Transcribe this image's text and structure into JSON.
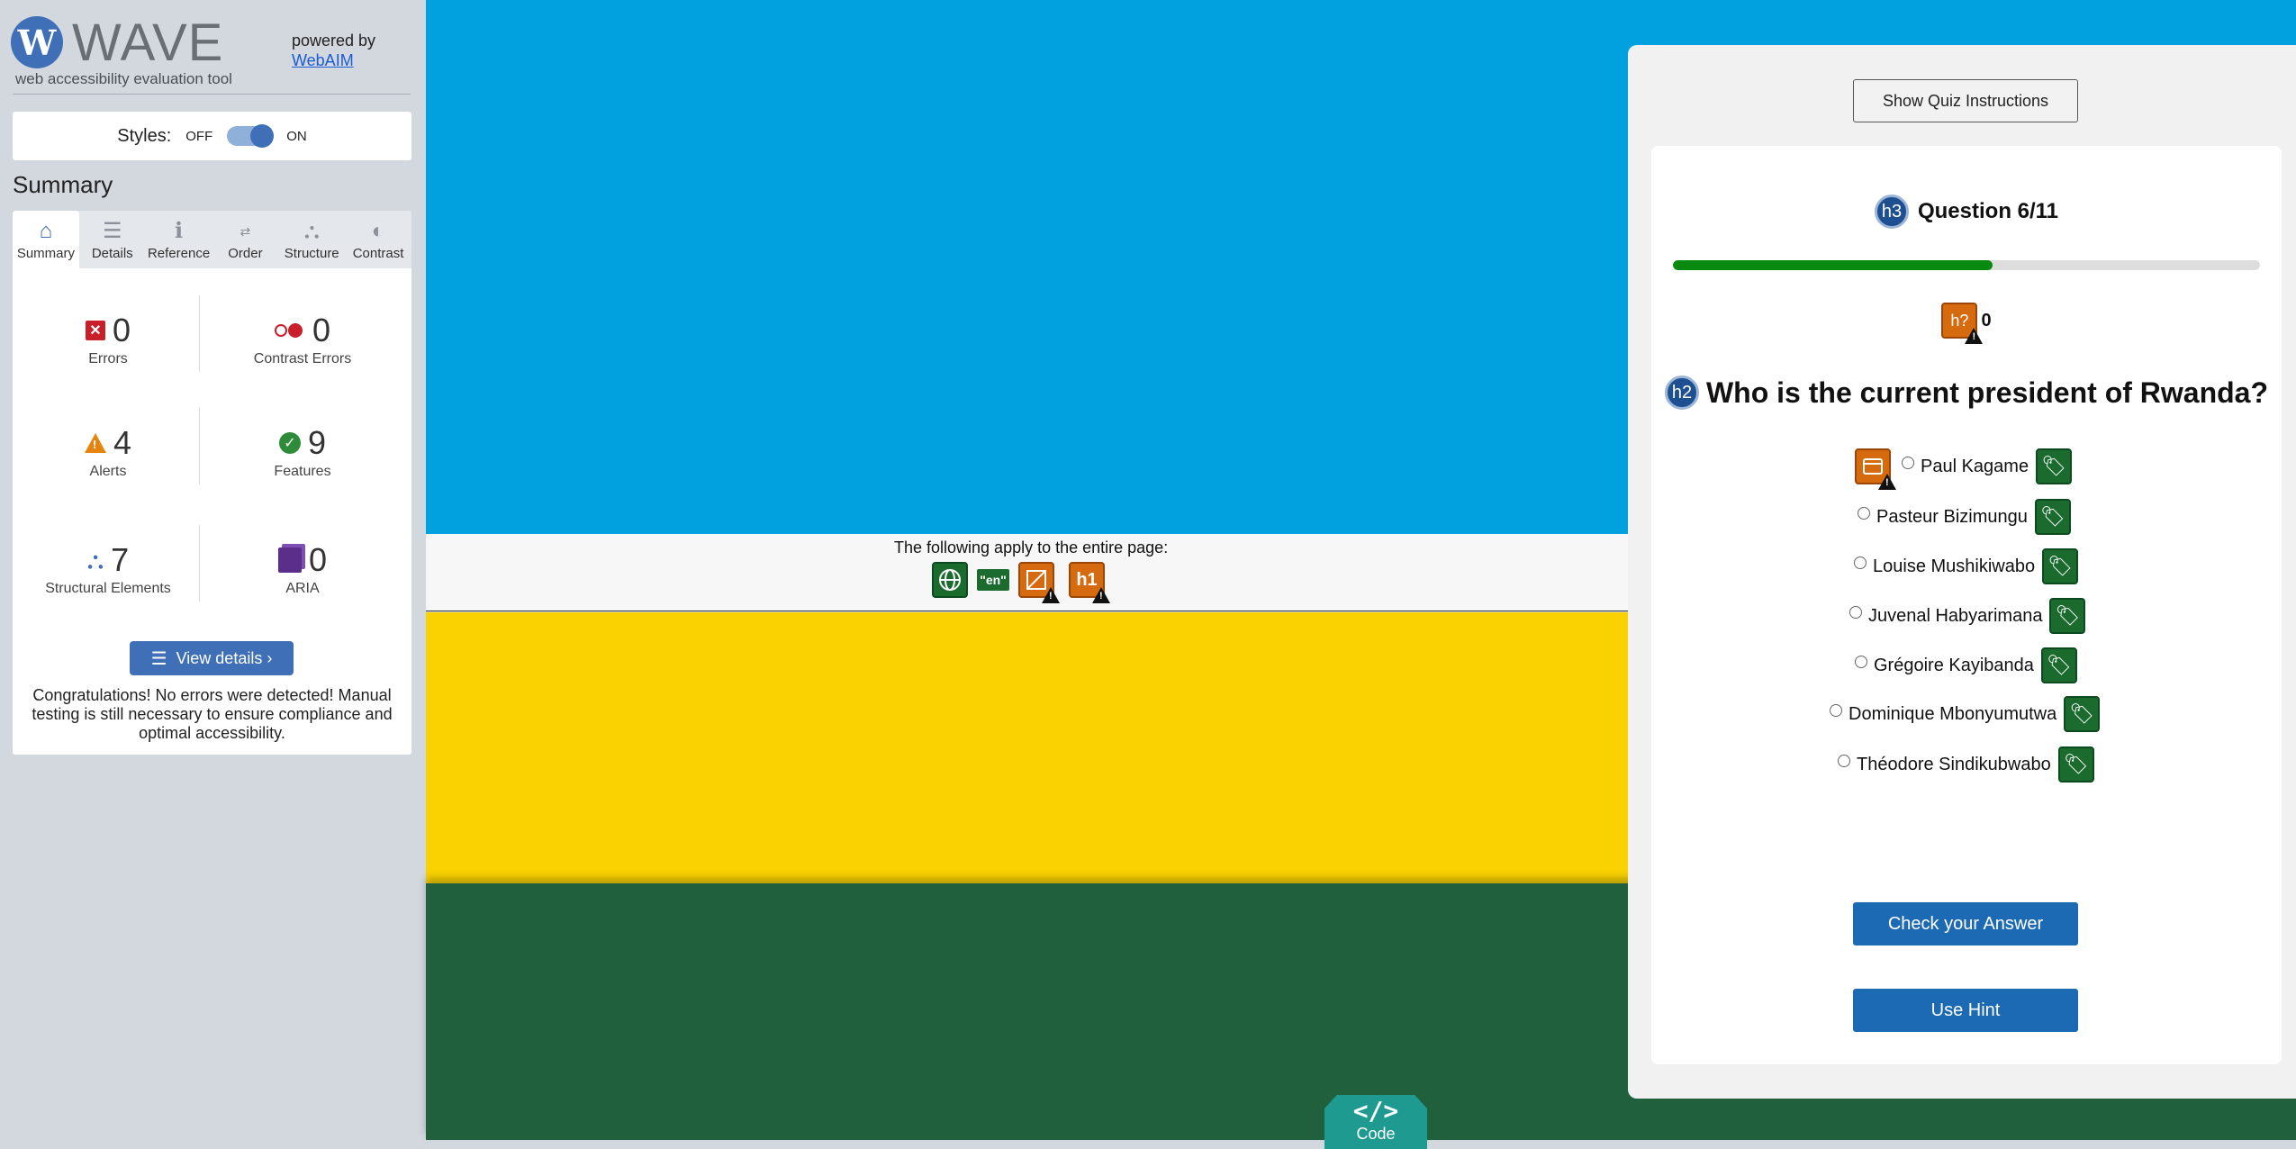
{
  "wave": {
    "logo_letter": "W",
    "title": "WAVE",
    "tagline": "web accessibility evaluation tool",
    "powered_by": "powered by",
    "webaim_link": "WebAIM",
    "styles_label": "Styles:",
    "styles_off": "OFF",
    "styles_on": "ON",
    "summary_heading": "Summary",
    "tabs": [
      {
        "label": "Summary",
        "icon": "home-icon"
      },
      {
        "label": "Details",
        "icon": "list-icon"
      },
      {
        "label": "Reference",
        "icon": "info-icon"
      },
      {
        "label": "Order",
        "icon": "order-icon"
      },
      {
        "label": "Structure",
        "icon": "structure-icon"
      },
      {
        "label": "Contrast",
        "icon": "contrast-icon"
      }
    ],
    "stats": {
      "errors": {
        "value": "0",
        "label": "Errors"
      },
      "contrast": {
        "value": "0",
        "label": "Contrast Errors"
      },
      "alerts": {
        "value": "4",
        "label": "Alerts"
      },
      "features": {
        "value": "9",
        "label": "Features"
      },
      "structural": {
        "value": "7",
        "label": "Structural Elements"
      },
      "aria": {
        "value": "0",
        "label": "ARIA"
      }
    },
    "view_details": "View details ›",
    "congrats": "Congratulations! No errors were detected! Manual testing is still necessary to ensure compliance and optimal accessibility."
  },
  "page": {
    "banner_text": "The following apply to the entire page:",
    "lang_badge": "\"en\"",
    "h1_badge": "h1",
    "code_glyph": "</>",
    "code_label": "Code"
  },
  "quiz": {
    "show_instructions": "Show Quiz Instructions",
    "h3_badge": "h3",
    "question_count": "Question 6/11",
    "progress_fraction": 0.545,
    "hq_badge": "h?",
    "hq_count": "0",
    "h2_badge": "h2",
    "question": "Who is the current president of Rwanda?",
    "options": [
      "Paul Kagame",
      "Pasteur Bizimungu",
      "Louise Mushikiwabo",
      "Juvenal Habyarimana",
      "Grégoire Kayibanda",
      "Dominique Mbonyumutwa",
      "Théodore Sindikubwabo"
    ],
    "check_button": "Check your Answer",
    "hint_button": "Use Hint"
  },
  "colors": {
    "blue_band": "#00a1de",
    "yellow_band": "#fad201",
    "green_band": "#20603d",
    "wave_accent": "#3f6fb6",
    "progress_fill": "#078a0f",
    "quiz_button": "#1c69b4"
  }
}
